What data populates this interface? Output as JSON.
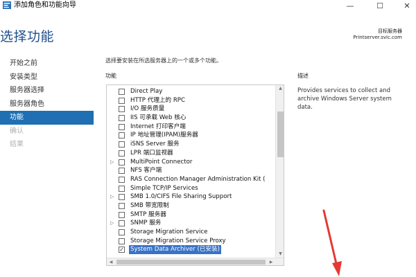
{
  "window": {
    "title": "添加角色和功能向导",
    "minimize": "—",
    "maximize": "☐",
    "close": "✕"
  },
  "header": {
    "title": "选择功能",
    "target_label": "目标服务器",
    "target_value": "Printserver.svic.com"
  },
  "nav": {
    "items": [
      {
        "label": "开始之前"
      },
      {
        "label": "安装类型"
      },
      {
        "label": "服务器选择"
      },
      {
        "label": "服务器角色"
      },
      {
        "label": "功能"
      },
      {
        "label": "确认"
      },
      {
        "label": "结果"
      }
    ]
  },
  "main": {
    "instruction": "选择要安装在所选服务器上的一个或多个功能。",
    "features_heading": "功能",
    "description_heading": "描述",
    "description_text": "Provides services to collect and archive Windows Server system data."
  },
  "features": [
    {
      "label": "Direct Play",
      "expandable": false,
      "checked": false
    },
    {
      "label": "HTTP 代理上的 RPC",
      "expandable": false,
      "checked": false
    },
    {
      "label": "I/O 服务质量",
      "expandable": false,
      "checked": false
    },
    {
      "label": "IIS 可承载 Web 核心",
      "expandable": false,
      "checked": false
    },
    {
      "label": "Internet 打印客户端",
      "expandable": false,
      "checked": false
    },
    {
      "label": "IP 地址管理(IPAM)服务器",
      "expandable": false,
      "checked": false
    },
    {
      "label": "iSNS Server 服务",
      "expandable": false,
      "checked": false
    },
    {
      "label": "LPR 端口监视器",
      "expandable": false,
      "checked": false
    },
    {
      "label": "MultiPoint Connector",
      "expandable": true,
      "checked": false
    },
    {
      "label": "NFS 客户端",
      "expandable": false,
      "checked": false
    },
    {
      "label": "RAS Connection Manager Administration Kit (",
      "expandable": false,
      "checked": false
    },
    {
      "label": "Simple TCP/IP Services",
      "expandable": false,
      "checked": false
    },
    {
      "label": "SMB 1.0/CIFS File Sharing Support",
      "expandable": true,
      "checked": false
    },
    {
      "label": "SMB 带宽限制",
      "expandable": false,
      "checked": false
    },
    {
      "label": "SMTP 服务器",
      "expandable": false,
      "checked": false
    },
    {
      "label": "SNMP 服务",
      "expandable": true,
      "checked": false
    },
    {
      "label": "Storage Migration Service",
      "expandable": false,
      "checked": false
    },
    {
      "label": "Storage Migration Service Proxy",
      "expandable": false,
      "checked": false
    },
    {
      "label": "System Data Archiver (已安装)",
      "expandable": false,
      "checked": true,
      "selected": true
    }
  ],
  "glyphs": {
    "expand": "▷",
    "check": "✓",
    "scroll_up": "▲",
    "scroll_down": "▼",
    "scroll_left": "◀",
    "scroll_right": "▶"
  },
  "colors": {
    "title_blue": "#1e4e8c",
    "nav_active": "#1f6fb2",
    "selection": "#3873c7",
    "annotation_arrow": "#e53935"
  }
}
